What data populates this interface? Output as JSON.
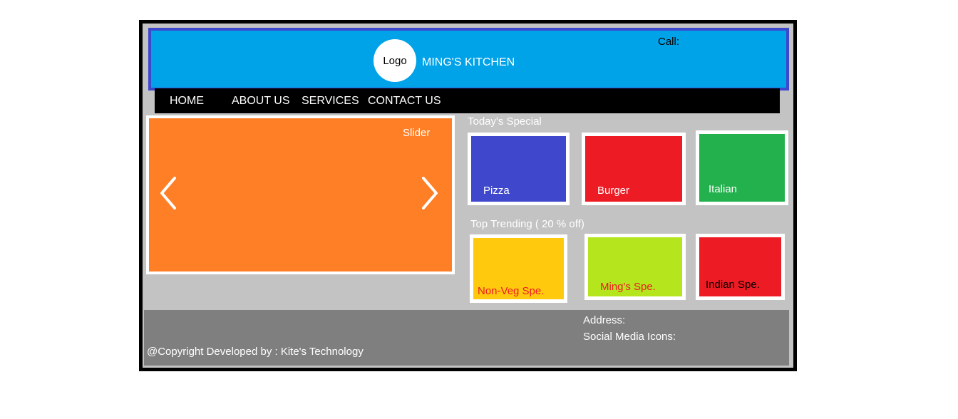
{
  "header": {
    "logo_text": "Logo",
    "brand_name": "MING'S KITCHEN",
    "call_label": "Call:"
  },
  "nav": {
    "items": [
      {
        "label": "HOME"
      },
      {
        "label": "ABOUT US"
      },
      {
        "label": "SERVICES"
      },
      {
        "label": "CONTACT US"
      }
    ]
  },
  "slider": {
    "title": "Slider",
    "prev_icon": "chevron-left-icon",
    "next_icon": "chevron-right-icon"
  },
  "todays_special": {
    "title": "Today's Special",
    "items": [
      {
        "label": "Pizza",
        "color": "#3f48cc",
        "text_color": "#ffffff"
      },
      {
        "label": "Burger",
        "color": "#ed1c24",
        "text_color": "#ffffff"
      },
      {
        "label": "Italian",
        "color": "#22b14c",
        "text_color": "#ffffff"
      }
    ]
  },
  "top_trending": {
    "title": "Top Trending  ( 20 % off)",
    "items": [
      {
        "label": "Non-Veg Spe.",
        "color": "#ffc90e",
        "text_color": "#ed1c24"
      },
      {
        "label": "Ming's Spe.",
        "color": "#b5e61d",
        "text_color": "#ed1c24"
      },
      {
        "label": "Indian Spe.",
        "color": "#ed1c24",
        "text_color": "#000000"
      }
    ]
  },
  "footer": {
    "address_label": "Address:",
    "social_label": "Social Media Icons:",
    "copyright": "@Copyright Developed by : Kite's Technology"
  }
}
